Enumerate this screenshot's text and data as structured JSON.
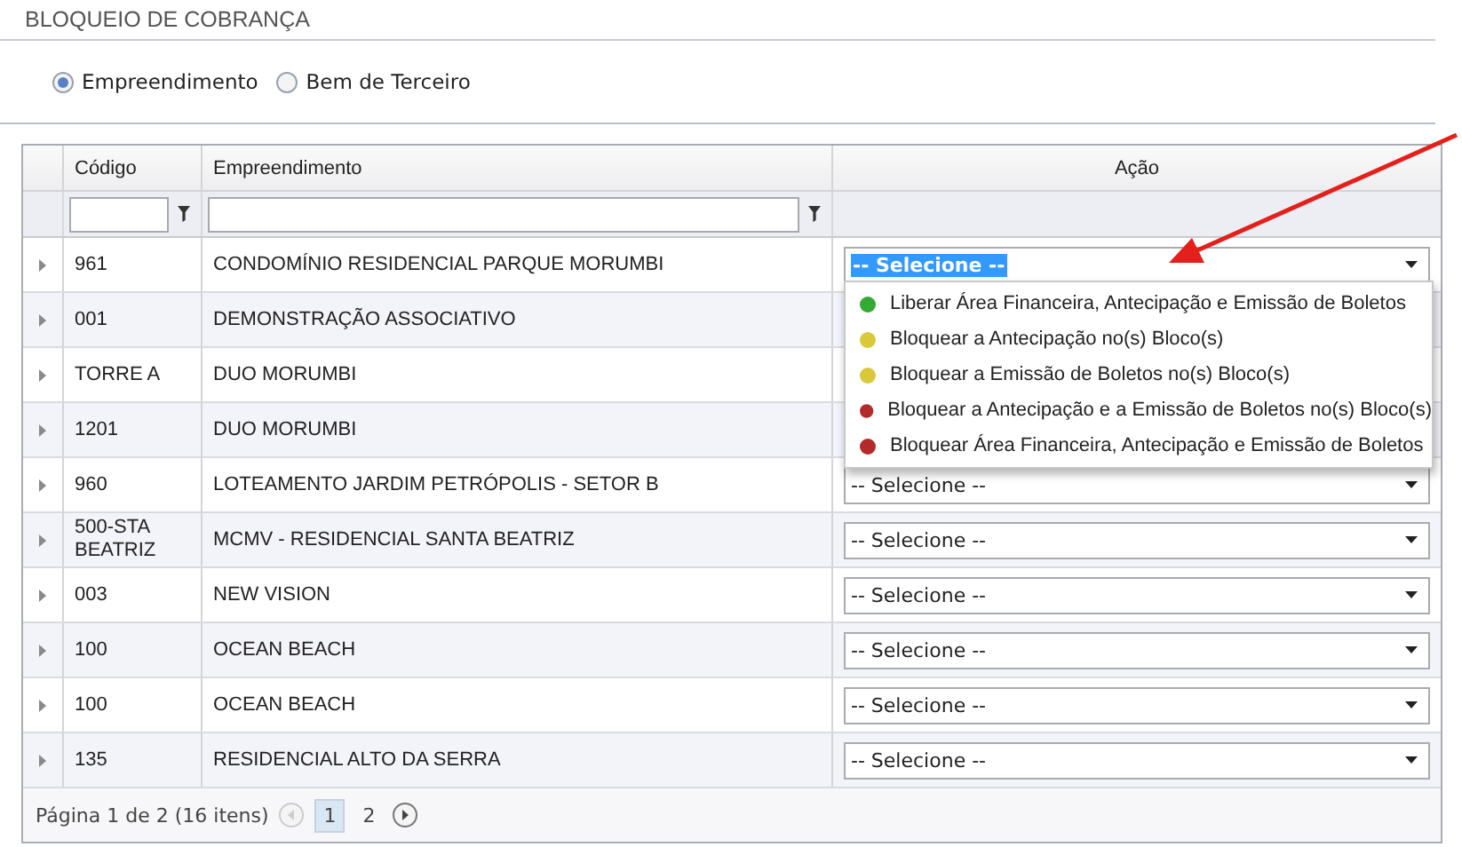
{
  "title": "BLOQUEIO DE COBRANÇA",
  "radios": [
    {
      "label": "Empreendimento",
      "selected": true
    },
    {
      "label": "Bem de Terceiro",
      "selected": false
    }
  ],
  "table": {
    "columns": [
      "Código",
      "Empreendimento",
      "Ação"
    ],
    "rows": [
      {
        "code": "961",
        "name": "CONDOMÍNIO RESIDENCIAL PARQUE MORUMBI",
        "action": "-- Selecione --",
        "open": true
      },
      {
        "code": "001",
        "name": "DEMONSTRAÇÃO ASSOCIATIVO"
      },
      {
        "code": "TORRE A",
        "name": "DUO MORUMBI"
      },
      {
        "code": "1201",
        "name": "DUO MORUMBI"
      },
      {
        "code": "960",
        "name": "LOTEAMENTO JARDIM PETRÓPOLIS - SETOR B",
        "action": "-- Selecione --"
      },
      {
        "code": "500-STA BEATRIZ",
        "name": "MCMV - RESIDENCIAL SANTA BEATRIZ",
        "action": "-- Selecione --"
      },
      {
        "code": "003",
        "name": "NEW VISION",
        "action": "-- Selecione --"
      },
      {
        "code": "100",
        "name": "OCEAN BEACH",
        "action": "-- Selecione --"
      },
      {
        "code": "100",
        "name": "OCEAN BEACH",
        "action": "-- Selecione --"
      },
      {
        "code": "135",
        "name": "RESIDENCIAL ALTO DA SERRA",
        "action": "-- Selecione --"
      }
    ],
    "options": [
      {
        "label": "Liberar Área Financeira, Antecipação e Emissão de Boletos",
        "color": "#33aa33"
      },
      {
        "label": "Bloquear a Antecipação no(s) Bloco(s)",
        "color": "#d8c83a"
      },
      {
        "label": "Bloquear a Emissão de Boletos no(s) Bloco(s)",
        "color": "#d8c83a"
      },
      {
        "label": "Bloquear a Antecipação e a Emissão de Boletos no(s) Bloco(s)",
        "color": "#b32a2a"
      },
      {
        "label": "Bloquear Área Financeira, Antecipação e Emissão de Boletos",
        "color": "#b32a2a"
      }
    ]
  },
  "pager": {
    "summary": "Página 1 de 2 (16 itens)",
    "pages": [
      {
        "label": "1",
        "selected": true
      },
      {
        "label": "2",
        "selected": false
      }
    ]
  }
}
